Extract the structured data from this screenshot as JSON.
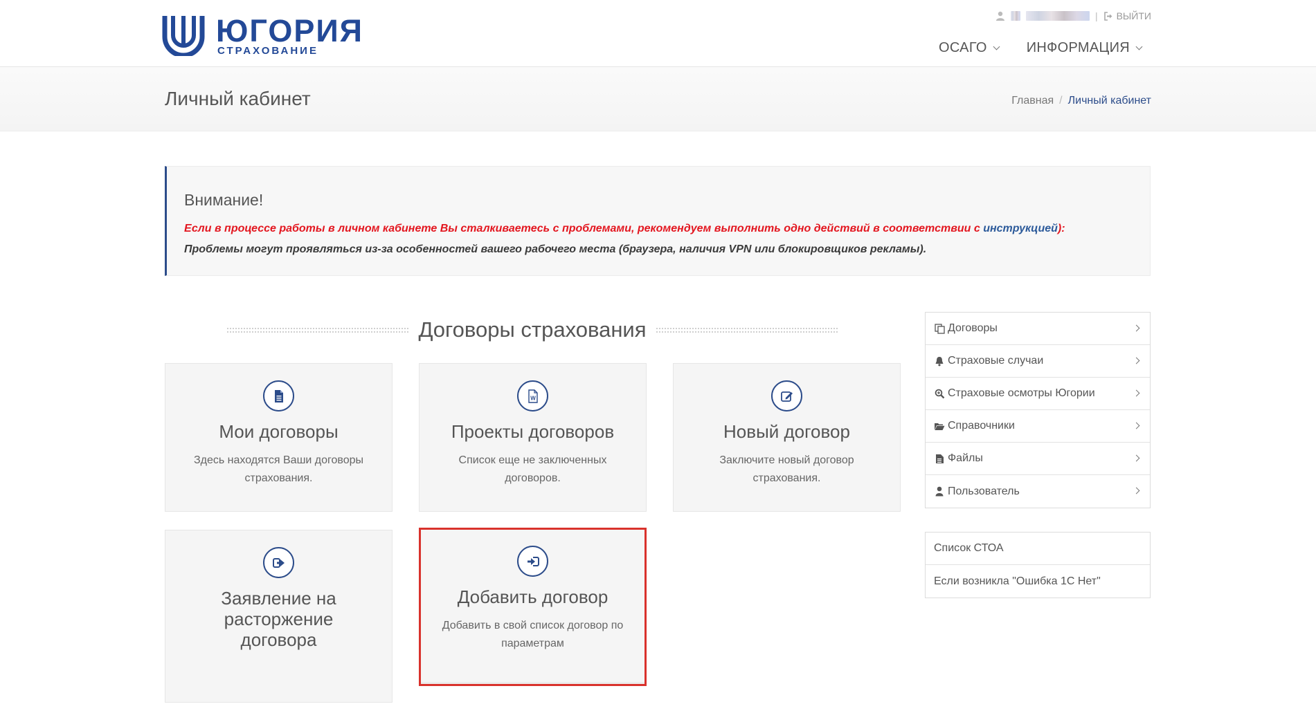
{
  "header": {
    "logo_word": "ЮГОРИЯ",
    "logo_sub": "СТРАХОВАНИЕ",
    "logout_label": "ВЫЙТИ",
    "nav": [
      {
        "label": "ОСАГО"
      },
      {
        "label": "ИНФОРМАЦИЯ"
      }
    ]
  },
  "page": {
    "title": "Личный кабинет",
    "breadcrumb": [
      {
        "label": "Главная"
      },
      {
        "label": "Личный кабинет"
      }
    ],
    "breadcrumb_divider": "/"
  },
  "alert": {
    "title": "Внимание!",
    "line1_before": "Если в процессе работы в личном кабинете Вы сталкиваетесь с проблемами, рекомендуем выполнить одно действий в соответствии с ",
    "line1_link": "инструкцией",
    "line1_after": "):",
    "line2": "Проблемы могут проявляться из-за особенностей вашего рабочего места (браузера, наличия VPN или блокировщиков рекламы)."
  },
  "section": {
    "title": "Договоры страхования"
  },
  "cards": [
    {
      "icon": "document-icon",
      "title": "Мои договоры",
      "desc": "Здесь находятся Ваши договоры страхования."
    },
    {
      "icon": "word-file-icon",
      "title": "Проекты договоров",
      "desc": "Список еще не заключенных договоров."
    },
    {
      "icon": "edit-icon",
      "title": "Новый договор",
      "desc": "Заключите новый договор страхования."
    },
    {
      "icon": "sign-out-icon",
      "title": "Заявление на расторжение договора",
      "desc": ""
    },
    {
      "icon": "sign-in-icon",
      "title": "Добавить договор",
      "desc": "Добавить в свой список договор по параметрам"
    }
  ],
  "sidebar": {
    "items": [
      {
        "icon": "copy-icon",
        "label": "Договоры"
      },
      {
        "icon": "bell-icon",
        "label": "Страховые случаи"
      },
      {
        "icon": "zoom-icon",
        "label": "Страховые осмотры Югории"
      },
      {
        "icon": "folder-open-icon",
        "label": "Справочники"
      },
      {
        "icon": "file-icon",
        "label": "Файлы"
      },
      {
        "icon": "user-icon",
        "label": "Пользователь"
      }
    ],
    "links": [
      {
        "label": "Список СТОА"
      },
      {
        "label": "Если возникла \"Ошибка 1С Нет\""
      }
    ]
  },
  "colors": {
    "brand": "#234997",
    "alert_text": "#e3161f",
    "highlight": "#d9322c"
  }
}
